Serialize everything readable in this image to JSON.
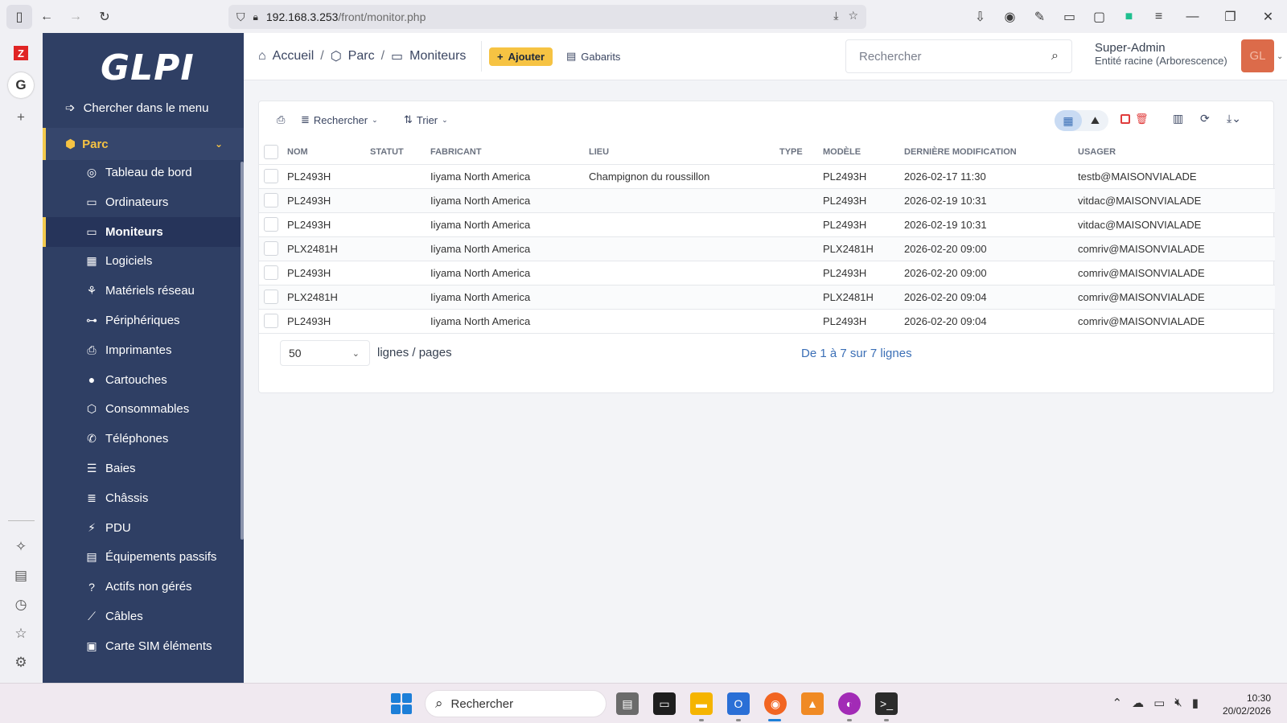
{
  "browser": {
    "url_host": "192.168.3.253",
    "url_path": "/front/monitor.php"
  },
  "sidebar": {
    "logo": "GLPI",
    "menu_search": "Chercher dans le menu",
    "section": "Parc",
    "items": [
      {
        "label": "Tableau de bord",
        "icon": "dashboard-icon"
      },
      {
        "label": "Ordinateurs",
        "icon": "laptop-icon"
      },
      {
        "label": "Moniteurs",
        "icon": "monitor-icon",
        "active": true
      },
      {
        "label": "Logiciels",
        "icon": "apps-icon"
      },
      {
        "label": "Matériels réseau",
        "icon": "network-icon"
      },
      {
        "label": "Périphériques",
        "icon": "usb-icon"
      },
      {
        "label": "Imprimantes",
        "icon": "printer-icon"
      },
      {
        "label": "Cartouches",
        "icon": "droplet-icon"
      },
      {
        "label": "Consommables",
        "icon": "box-icon"
      },
      {
        "label": "Téléphones",
        "icon": "phone-icon"
      },
      {
        "label": "Baies",
        "icon": "server-icon"
      },
      {
        "label": "Châssis",
        "icon": "list-icon"
      },
      {
        "label": "PDU",
        "icon": "plug-icon"
      },
      {
        "label": "Équipements passifs",
        "icon": "layout-icon"
      },
      {
        "label": "Actifs non gérés",
        "icon": "question-icon"
      },
      {
        "label": "Câbles",
        "icon": "cable-icon"
      },
      {
        "label": "Carte SIM éléments",
        "icon": "sim-icon"
      }
    ]
  },
  "header": {
    "breadcrumb": [
      "Accueil",
      "Parc",
      "Moniteurs"
    ],
    "add_label": "Ajouter",
    "templates_label": "Gabarits",
    "search_placeholder": "Rechercher",
    "user_name": "Super-Admin",
    "user_entity": "Entité racine (Arborescence)",
    "avatar_initials": "GL"
  },
  "toolbar": {
    "search_label": "Rechercher",
    "sort_label": "Trier"
  },
  "table": {
    "columns": [
      "NOM",
      "STATUT",
      "FABRICANT",
      "LIEU",
      "TYPE",
      "MODÈLE",
      "DERNIÈRE MODIFICATION",
      "USAGER"
    ],
    "rows": [
      {
        "nom": "PL2493H",
        "statut": "",
        "fabricant": "Iiyama North America",
        "lieu": "Champignon du roussillon",
        "type": "",
        "modele": "PL2493H",
        "modif": "2026-02-17 11:30",
        "usager": "testb@MAISONVIALADE"
      },
      {
        "nom": "PL2493H",
        "statut": "",
        "fabricant": "Iiyama North America",
        "lieu": "",
        "type": "",
        "modele": "PL2493H",
        "modif": "2026-02-19 10:31",
        "usager": "vitdac@MAISONVIALADE"
      },
      {
        "nom": "PL2493H",
        "statut": "",
        "fabricant": "Iiyama North America",
        "lieu": "",
        "type": "",
        "modele": "PL2493H",
        "modif": "2026-02-19 10:31",
        "usager": "vitdac@MAISONVIALADE"
      },
      {
        "nom": "PLX2481H",
        "statut": "",
        "fabricant": "Iiyama North America",
        "lieu": "",
        "type": "",
        "modele": "PLX2481H",
        "modif": "2026-02-20 09:00",
        "usager": "comriv@MAISONVIALADE"
      },
      {
        "nom": "PL2493H",
        "statut": "",
        "fabricant": "Iiyama North America",
        "lieu": "",
        "type": "",
        "modele": "PL2493H",
        "modif": "2026-02-20 09:00",
        "usager": "comriv@MAISONVIALADE"
      },
      {
        "nom": "PLX2481H",
        "statut": "",
        "fabricant": "Iiyama North America",
        "lieu": "",
        "type": "",
        "modele": "PLX2481H",
        "modif": "2026-02-20 09:04",
        "usager": "comriv@MAISONVIALADE"
      },
      {
        "nom": "PL2493H",
        "statut": "",
        "fabricant": "Iiyama North America",
        "lieu": "",
        "type": "",
        "modele": "PL2493H",
        "modif": "2026-02-20 09:04",
        "usager": "comriv@MAISONVIALADE"
      }
    ]
  },
  "pager": {
    "page_size": "50",
    "page_size_label": "lignes / pages",
    "count_text": "De 1 à 7 sur 7 lignes"
  },
  "taskbar": {
    "search_label": "Rechercher",
    "time": "10:30",
    "date": "20/02/2026"
  },
  "colors": {
    "sidebar_bg": "#2f3f64",
    "accent": "#f6c343",
    "link": "#206bc4"
  }
}
